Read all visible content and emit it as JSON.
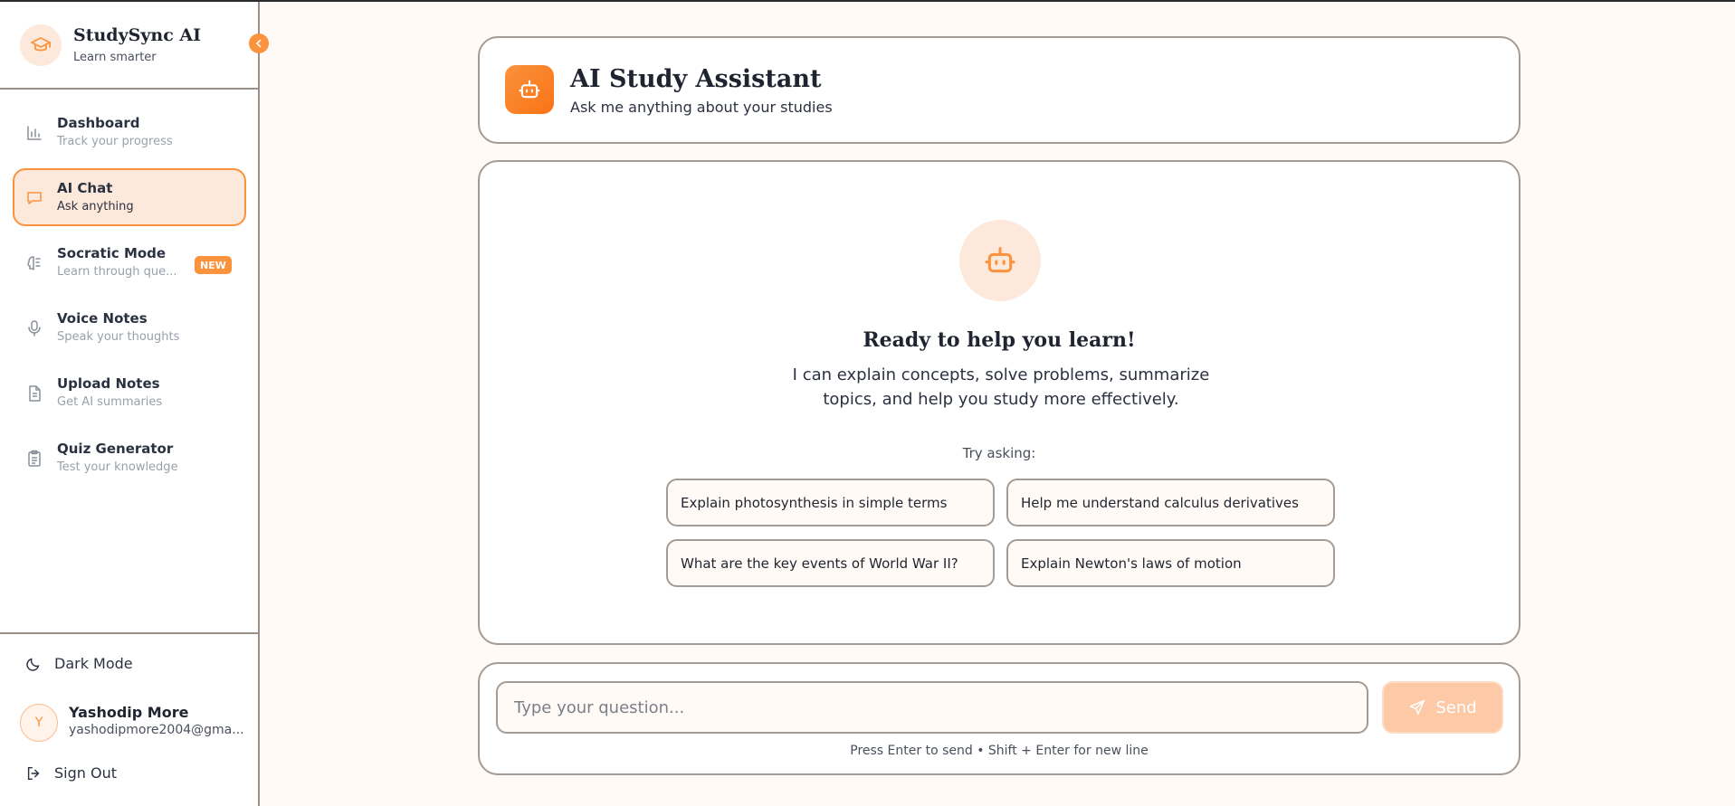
{
  "brand": {
    "title": "StudySync AI",
    "subtitle": "Learn smarter"
  },
  "nav": [
    {
      "label": "Dashboard",
      "sub": "Track your progress",
      "icon": "bar-chart-icon",
      "active": false
    },
    {
      "label": "AI Chat",
      "sub": "Ask anything",
      "icon": "chat-bubble-icon",
      "active": true
    },
    {
      "label": "Socratic Mode",
      "sub": "Learn through que...",
      "icon": "brain-icon",
      "badge": "NEW",
      "active": false
    },
    {
      "label": "Voice Notes",
      "sub": "Speak your thoughts",
      "icon": "microphone-icon",
      "active": false
    },
    {
      "label": "Upload Notes",
      "sub": "Get AI summaries",
      "icon": "document-icon",
      "active": false
    },
    {
      "label": "Quiz Generator",
      "sub": "Test your knowledge",
      "icon": "clipboard-icon",
      "active": false
    }
  ],
  "sidebar_bottom": {
    "dark_mode": "Dark Mode",
    "user": {
      "initial": "Y",
      "name": "Yashodip More",
      "email": "yashodipmore2004@gma..."
    },
    "sign_out": "Sign Out"
  },
  "header": {
    "title": "AI Study Assistant",
    "subtitle": "Ask me anything about your studies"
  },
  "empty_state": {
    "title": "Ready to help you learn!",
    "description": "I can explain concepts, solve problems, summarize topics, and help you study more effectively.",
    "try_label": "Try asking:",
    "suggestions": [
      "Explain photosynthesis in simple terms",
      "Help me understand calculus derivatives",
      "What are the key events of World War II?",
      "Explain Newton's laws of motion"
    ]
  },
  "composer": {
    "placeholder": "Type your question...",
    "send_label": "Send",
    "hint": "Press Enter to send • Shift + Enter for new line"
  },
  "colors": {
    "accent": "#fb923c",
    "accent_soft": "#fde9dc",
    "background": "#fffaf6",
    "border": "#a49b94"
  }
}
